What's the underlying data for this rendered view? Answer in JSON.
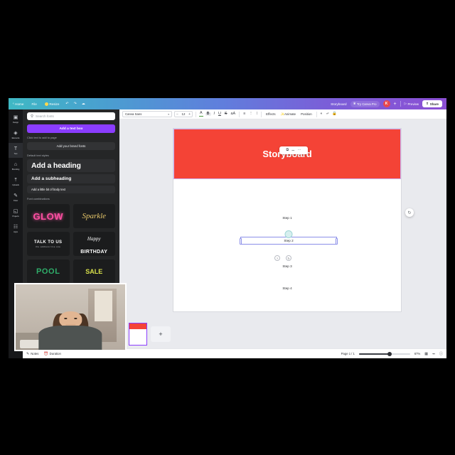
{
  "topbar": {
    "home": "Home",
    "file": "File",
    "resize": "Resize",
    "undo_icon": "undo-icon",
    "redo_icon": "redo-icon",
    "cloud_icon": "cloud-saved-icon",
    "doc_title": "Storyboard",
    "pro_label": "Try Canva Pro",
    "avatar_initial": "K",
    "plus_label": "+",
    "preview_label": "Preview",
    "share_label": "Share"
  },
  "rail": {
    "items": [
      {
        "label": "Design",
        "icon": "design-icon",
        "glyph": "⌸"
      },
      {
        "label": "Elements",
        "icon": "elements-icon",
        "glyph": "◈"
      },
      {
        "label": "Text",
        "icon": "text-icon",
        "glyph": "T"
      },
      {
        "label": "Branding",
        "icon": "branding-icon",
        "glyph": "⌂"
      },
      {
        "label": "Uploads",
        "icon": "uploads-icon",
        "glyph": "⤒"
      },
      {
        "label": "Draw",
        "icon": "draw-icon",
        "glyph": "✎"
      },
      {
        "label": "Projects",
        "icon": "projects-icon",
        "glyph": "◱"
      },
      {
        "label": "Apps",
        "icon": "apps-icon",
        "glyph": "☷"
      }
    ],
    "active_index": 2
  },
  "panel": {
    "search_placeholder": "Search fonts",
    "add_text_box": "Add a text box",
    "click_hint": "Click text to add to page",
    "brand_fonts": "Add your brand fonts",
    "default_styles_label": "Default text styles",
    "heading": "Add a heading",
    "subheading": "Add a subheading",
    "body": "Add a little bit of body text",
    "font_combinations_label": "Font combinations",
    "combos": [
      {
        "name": "glow",
        "text": "GLOW"
      },
      {
        "name": "sparkle",
        "text": "Sparkle"
      },
      {
        "name": "talk-to-us",
        "text": "TALK TO US",
        "sub": "the address line one"
      },
      {
        "name": "happy-birthday",
        "script": "Happy",
        "block": "BIRTHDAY"
      },
      {
        "name": "pool",
        "text": "POOL"
      },
      {
        "name": "sale",
        "text": "SALE"
      }
    ]
  },
  "toolbar": {
    "font_name": "Canva Sans",
    "font_size": "12",
    "minus": "−",
    "plus": "+",
    "text_color_icon": "text-color-icon",
    "bold": "B",
    "italic": "I",
    "underline": "U",
    "strikethrough": "S",
    "case_icon": "letter-case-icon",
    "align_icon": "align-icon",
    "list_icon": "bullet-list-icon",
    "spacing_icon": "line-spacing-icon",
    "effects": "Effects",
    "animate": "Animate",
    "position": "Position",
    "transparency_icon": "transparency-icon",
    "copy_style_icon": "copy-style-icon",
    "lock_icon": "lock-icon"
  },
  "canvas": {
    "banner_title": "Storyboard",
    "banner_color": "#f44336",
    "steps": [
      {
        "label": "Step 1"
      },
      {
        "label": "Step 2"
      },
      {
        "label": "Step 3"
      },
      {
        "label": "Step 4"
      }
    ],
    "selected_step": "Step 2",
    "context_icons": [
      "duplicate-icon",
      "trash-icon",
      "more-options-icon"
    ],
    "context_glyphs": [
      "⧉",
      "Ὕ1",
      "⋯"
    ],
    "ghost_glyphs": [
      "?",
      "↻"
    ],
    "rotate_icon": "rotate-handle-icon"
  },
  "thumbstrip": {
    "add_page_label": "+"
  },
  "bottombar": {
    "notes_label": "Notes",
    "notes_icon": "notes-icon",
    "duration_label": "Duration",
    "duration_icon": "duration-icon",
    "page_indicator": "Page 1 / 1",
    "zoom_value": "67%",
    "grid_icon": "grid-view-icon",
    "expand_icon": "fullscreen-icon",
    "help_icon": "help-icon"
  }
}
